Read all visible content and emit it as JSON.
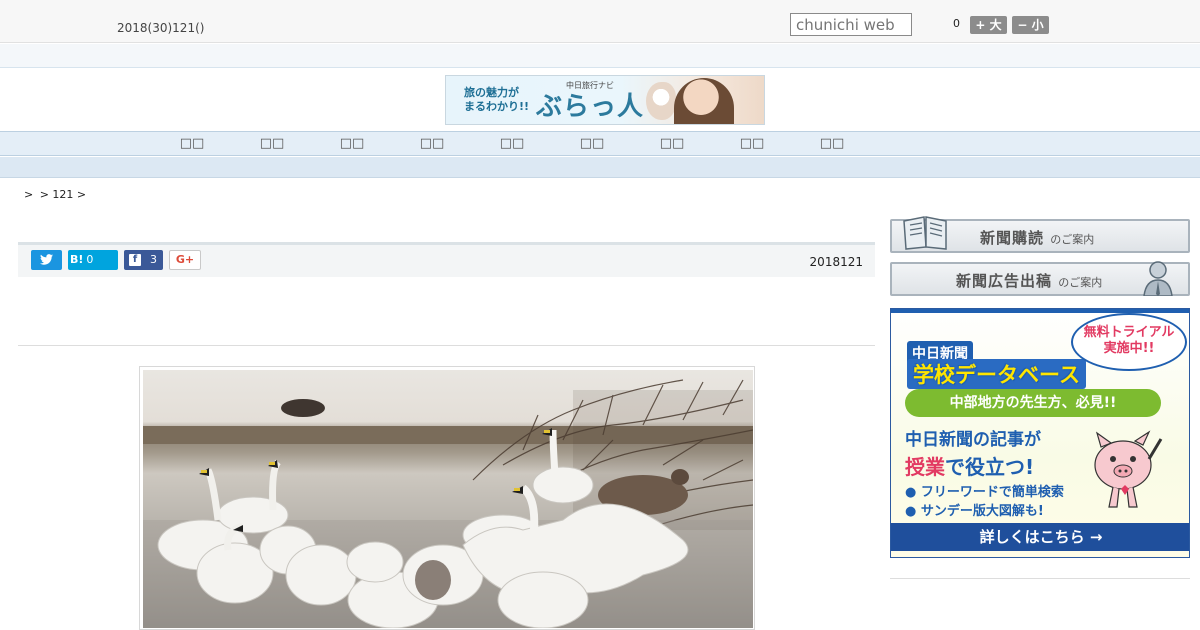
{
  "header": {
    "date": "2018(30)121()",
    "search_placeholder": "chunichi web",
    "font_size_value": "0",
    "font_larger": "+ 大",
    "font_smaller": "− 小"
  },
  "banner": {
    "tagline": "旅の魅力が\nまるわかり!!",
    "small": "中日旅行ナビ",
    "logo": "ぶらっ人"
  },
  "nav": {
    "items": [
      "□□",
      "□□",
      "□□",
      "□□",
      "□□",
      "□□",
      "□□",
      "□□",
      "□□"
    ]
  },
  "breadcrumb": [
    ">",
    "> 121 >"
  ],
  "article": {
    "date": "2018121",
    "share": {
      "twitter_icon": "twitter-bird-icon",
      "hatena_label": "B!",
      "hatena_count": "0",
      "facebook_icon_label": "f",
      "facebook_count": "3",
      "gplus_label": "G+"
    },
    "photo_icon": "swans-photo"
  },
  "sidebar": {
    "subscribe_label": "新聞購読",
    "subscribe_suffix": "のご案内",
    "ad_label": "新聞広告出稿",
    "ad_suffix": "のご案内",
    "promo": {
      "school": "中日新聞",
      "database": "学校データベース",
      "trial": "無料トライアル\n実施中!!",
      "pill": "中部地方の先生方、必見!!",
      "line1": "中日新聞の記事が",
      "line2_pink": "授業",
      "line2_rest": "で役立つ!",
      "bullet1": "● フリーワードで簡単検索",
      "bullet2": "● サンデー版大図解も!",
      "cta": "詳しくはこちら →"
    }
  },
  "colors": {
    "nav_bg": "#e4eef7",
    "promo_blue": "#1f5fb0",
    "promo_pink": "#e23a62",
    "promo_green": "#7dbb30"
  }
}
